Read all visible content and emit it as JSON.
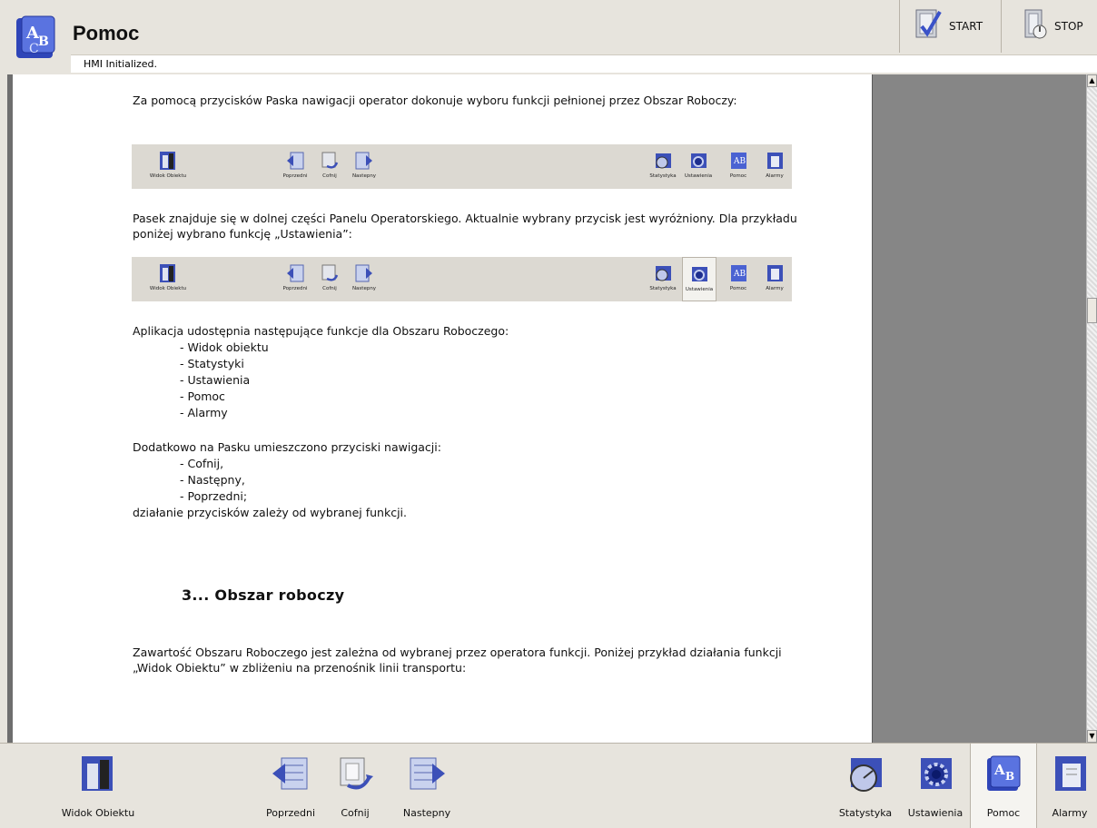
{
  "header": {
    "title": "Pomoc",
    "status": "HMI Initialized.",
    "start_label": "START",
    "stop_label": "STOP"
  },
  "content": {
    "para1": "Za pomocą przycisków Paska nawigacji operator dokonuje wyboru funkcji pełnionej przez Obszar Roboczy:",
    "para2": "Pasek znajduje się w dolnej części Panelu Operatorskiego. Aktualnie wybrany przycisk jest wyróżniony. Dla przykładu poniżej wybrano funkcję „Ustawienia”:",
    "para3": "Aplikacja udostępnia następujące funkcje dla Obszaru Roboczego:",
    "functions": [
      "- Widok obiektu",
      "- Statystyki",
      "- Ustawienia",
      "- Pomoc",
      "- Alarmy"
    ],
    "para4": "Dodatkowo na Pasku umieszczono przyciski nawigacji:",
    "nav_buttons": [
      "- Cofnij,",
      "- Następny,",
      "- Poprzedni;"
    ],
    "para5": "działanie przycisków zależy od wybranej funkcji.",
    "heading": "3... Obszar roboczy",
    "para6": "Zawartość Obszaru Roboczego jest zależna od wybranej przez operatora funkcji. Poniżej przykład działania funkcji „Widok Obiektu” w zbliżeniu na przenośnik linii transportu:",
    "mini_labels": {
      "widok": "Widok Obiektu",
      "poprzedni": "Poprzedni",
      "cofnij": "Cofnij",
      "nastepny": "Nastepny",
      "statystyka": "Statystyka",
      "ustawienia": "Ustawienia",
      "pomoc": "Pomoc",
      "alarmy": "Alarmy"
    }
  },
  "bottom_nav": {
    "widok": "Widok Obiektu",
    "poprzedni": "Poprzedni",
    "cofnij": "Cofnij",
    "nastepny": "Nastepny",
    "statystyka": "Statystyka",
    "ustawienia": "Ustawienia",
    "pomoc": "Pomoc",
    "alarmy": "Alarmy",
    "selected": "Pomoc"
  },
  "colors": {
    "accent_blue": "#3a52c8",
    "panel_bg": "#e7e4dd",
    "right_pane": "#868686"
  }
}
